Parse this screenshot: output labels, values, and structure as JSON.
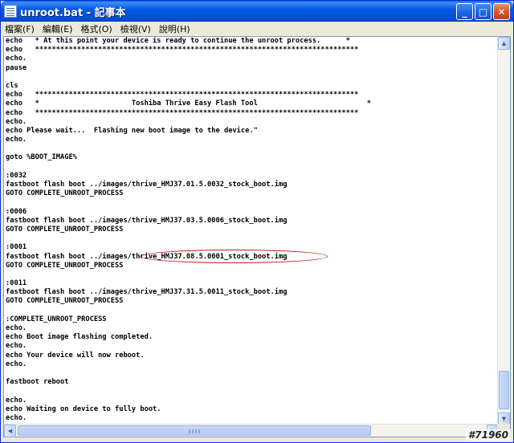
{
  "window": {
    "title": "unroot.bat - 記事本",
    "controls": {
      "minimize": "_",
      "maximize": "□",
      "close": "✕"
    }
  },
  "menubar": {
    "items": [
      {
        "label": "檔案(F)"
      },
      {
        "label": "編輯(E)"
      },
      {
        "label": "格式(O)"
      },
      {
        "label": "檢視(V)"
      },
      {
        "label": "說明(H)"
      }
    ]
  },
  "editor": {
    "lines": [
      "echo   * At this point your device is ready to continue the unroot process.      *",
      "echo   *****************************************************************************",
      "echo.",
      "pause",
      "",
      "cls",
      "echo   *****************************************************************************",
      "echo   *                      Toshiba Thrive Easy Flash Tool                          *",
      "echo   *****************************************************************************",
      "echo.",
      "echo Please wait...  Flashing new boot image to the device.\"",
      "echo.",
      "",
      "goto %BOOT_IMAGE%",
      "",
      ":0032",
      "fastboot flash boot ../images/thrive_HMJ37.01.5.0032_stock_boot.img",
      "GOTO COMPLETE_UNROOT_PROCESS",
      "",
      ":0006",
      "fastboot flash boot ../images/thrive_HMJ37.03.5.0006_stock_boot.img",
      "GOTO COMPLETE_UNROOT_PROCESS",
      "",
      ":0001",
      "fastboot flash boot ../images/thrive_HMJ37.08.5.0001_stock_boot.img",
      "GOTO COMPLETE_UNROOT_PROCESS",
      "",
      ":0011",
      "fastboot flash boot ../images/thrive_HMJ37.31.5.0011_stock_boot.img",
      "GOTO COMPLETE_UNROOT_PROCESS",
      "",
      ":COMPLETE_UNROOT_PROCESS",
      "echo.",
      "echo Boot image flashing completed.",
      "echo.",
      "echo Your device will now reboot.",
      "echo.",
      "",
      "fastboot reboot",
      "",
      "echo.",
      "echo Waiting on device to fully boot.",
      "echo."
    ]
  },
  "scrollbars": {
    "up": "▲",
    "down": "▼",
    "left": "◀",
    "right": "▶"
  },
  "watermark": "#71960",
  "colors": {
    "titlebar": "#0458e0",
    "annotation": "#c01818"
  }
}
